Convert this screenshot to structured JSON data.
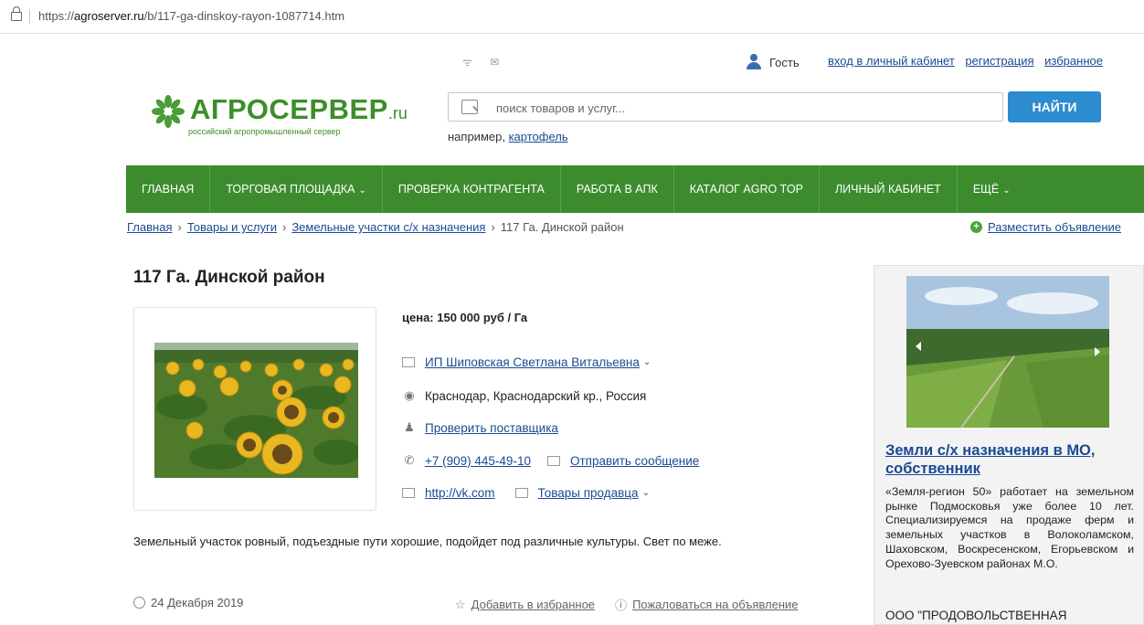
{
  "browser": {
    "url_prefix": "https://",
    "url_domain": "agroserver.ru",
    "url_path": "/b/117-ga-dinskoy-rayon-1087714.htm"
  },
  "header": {
    "top_icons": "ᯤ ✉",
    "guest_label": "Гость",
    "login_link": "вход в личный кабинет",
    "register_link": "регистрация",
    "favorites_link": "избранное"
  },
  "logo": {
    "name": "АГРОСЕРВЕР",
    "suffix": ".ru",
    "tagline": "российский агропромышленный сервер"
  },
  "search": {
    "placeholder": "поиск товаров и услуг...",
    "button_label": "НАЙТИ",
    "example_prefix": "например, ",
    "example_link": "картофель"
  },
  "nav": {
    "items": [
      {
        "label": "ГЛАВНАЯ"
      },
      {
        "label": "ТОРГОВАЯ ПЛОЩАДКА"
      },
      {
        "label": "ПРОВЕРКА КОНТРАГЕНТА"
      },
      {
        "label": "РАБОТА В АПК"
      },
      {
        "label": "КАТАЛОГ AGRO TOP"
      },
      {
        "label": "ЛИЧНЫЙ КАБИНЕТ"
      },
      {
        "label": "ЕЩЁ"
      }
    ]
  },
  "breadcrumb": {
    "items": [
      "Главная",
      "Товары и услуги",
      "Земельные участки с/х назначения"
    ],
    "current": "117 Га. Динской район",
    "separator": "›",
    "post_ad": "Разместить объявление"
  },
  "listing": {
    "title": "117 Га. Динской район",
    "price": "цена: 150 000 руб / Га",
    "seller": "ИП Шиповская Светлана Витальевна",
    "location": "Краснодар, Краснодарский кр., Россия",
    "check_supplier": "Проверить поставщика",
    "phone": "+7 (909) 445-49-10",
    "send_message": "Отправить сообщение",
    "website": "http://vk.com",
    "seller_goods": "Товары продавца",
    "description": "Земельный участок ровный, подъездные пути хорошие, подойдет под различные культуры. Свет по меже.",
    "date": "24 Декабря 2019",
    "add_favorite": "Добавить в избранное",
    "report": "Пожаловаться на объявление"
  },
  "ad": {
    "title": "Земли с/х назначения в МО, собственник",
    "text": "«Земля-регион 50» работает на земельном рынке Подмосковья уже более 10 лет. Специализируемся на продаже ферм и земельных участков в Волоколамском, Шаховском, Воскресенском, Егорьевском и Орехово-Зуевском районах М.О.",
    "company": "ООО \"ПРОДОВОЛЬСТВЕННАЯ"
  },
  "colors": {
    "brand_green": "#3c8c2e",
    "button_blue": "#2d8bd0",
    "link_blue": "#1a4b93"
  }
}
